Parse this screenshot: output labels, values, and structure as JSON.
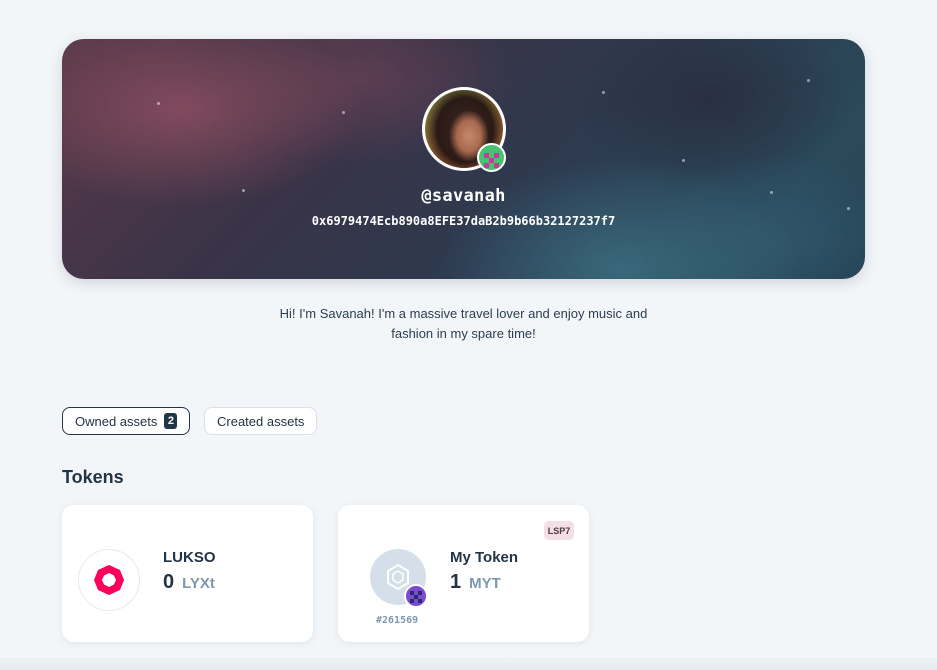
{
  "profile": {
    "username": "@savanah",
    "address": "0x6979474Ecb890a8EFE37daB2b9b66b32127237f7",
    "bio_line1": "Hi! I'm Savanah! I'm a massive travel lover and enjoy music and",
    "bio_line2": "fashion in my spare time!"
  },
  "tabs": [
    {
      "label": "Owned assets",
      "count": "2",
      "active": true
    },
    {
      "label": "Created assets",
      "active": false
    }
  ],
  "tokens_section": {
    "title": "Tokens",
    "cards": [
      {
        "name": "LUKSO",
        "amount": "0",
        "symbol": "LYXt",
        "icon": "lukso-logo-icon"
      },
      {
        "name": "My Token",
        "amount": "1",
        "symbol": "MYT",
        "standard": "LSP7",
        "token_id": "#261569",
        "icon": "token-placeholder-icon"
      }
    ]
  },
  "colors": {
    "accent_dark": "#243447",
    "muted_symbol": "#7e97b0",
    "lukso_pink": "#fe005b",
    "page_bg": "#f3f6f9",
    "badge_bg": "#f3dfe4"
  }
}
